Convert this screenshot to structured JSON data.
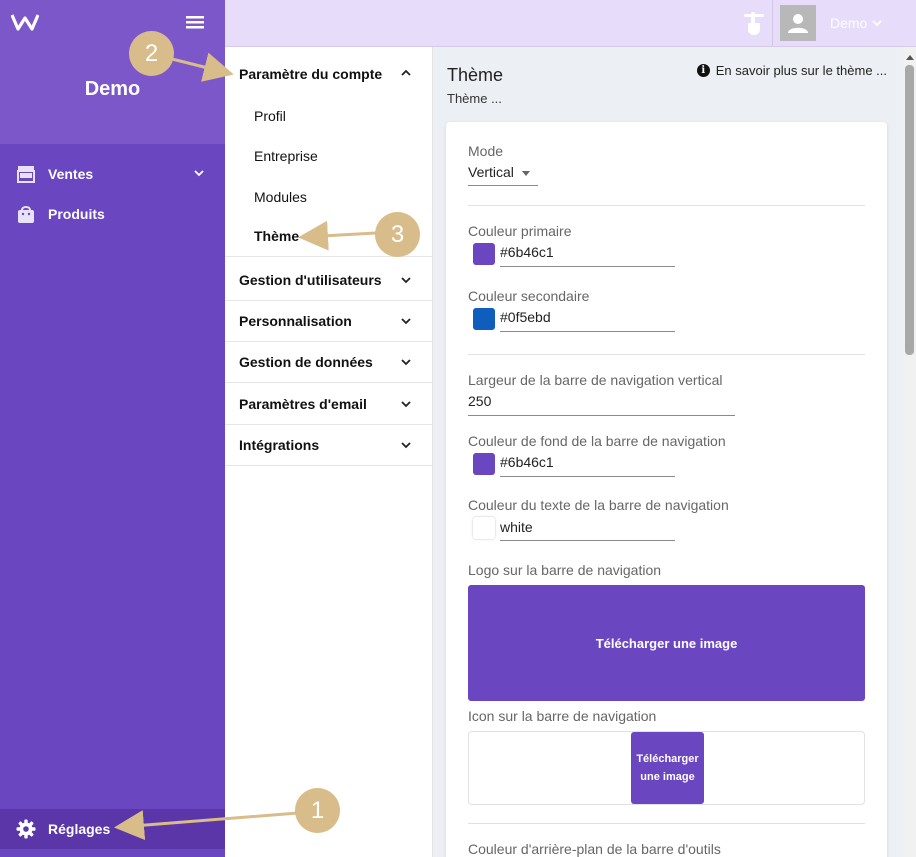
{
  "sidebar": {
    "title": "Demo",
    "items": [
      {
        "label": "Ventes",
        "icon": "store-icon"
      },
      {
        "label": "Produits",
        "icon": "shopping-bag-icon"
      }
    ],
    "settings_label": "Réglages",
    "background": "#6b46c1"
  },
  "topbar": {
    "user_name": "Demo",
    "background": "#e7dcfa"
  },
  "settings_nav": {
    "groups": [
      {
        "label": "Paramètre du compte",
        "expanded": true,
        "subitems": [
          "Profil",
          "Entreprise",
          "Modules",
          "Thème"
        ]
      },
      {
        "label": "Gestion d'utilisateurs"
      },
      {
        "label": "Personnalisation"
      },
      {
        "label": "Gestion de données"
      },
      {
        "label": "Paramètres d'email"
      },
      {
        "label": "Intégrations"
      }
    ],
    "active_subitem": "Thème"
  },
  "main": {
    "title": "Thème",
    "subtitle": "Thème ...",
    "learn_more": "En savoir plus sur le thème ...",
    "form": {
      "mode_label": "Mode",
      "mode_value": "Vertical",
      "primary_label": "Couleur primaire",
      "primary_value": "#6b46c1",
      "secondary_label": "Couleur secondaire",
      "secondary_value": "#0f5ebd",
      "nav_width_label": "Largeur de la barre de navigation vertical",
      "nav_width_value": "250",
      "nav_bg_label": "Couleur de fond de la barre de navigation",
      "nav_bg_value": "#6b46c1",
      "nav_text_label": "Couleur du texte de la barre de navigation",
      "nav_text_value": "white",
      "nav_logo_label": "Logo sur la barre de navigation",
      "upload_label": "Télécharger une image",
      "nav_icon_label": "Icon sur la barre de navigation",
      "upload_small_label": "Télécharger une image",
      "toolbar_bg_label": "Couleur d'arrière-plan de la barre d'outils"
    }
  },
  "annotations": [
    "1",
    "2",
    "3"
  ],
  "colors": {
    "accent": "#6b46c1",
    "secondary": "#0f5ebd",
    "badge": "#d8bc8a"
  }
}
